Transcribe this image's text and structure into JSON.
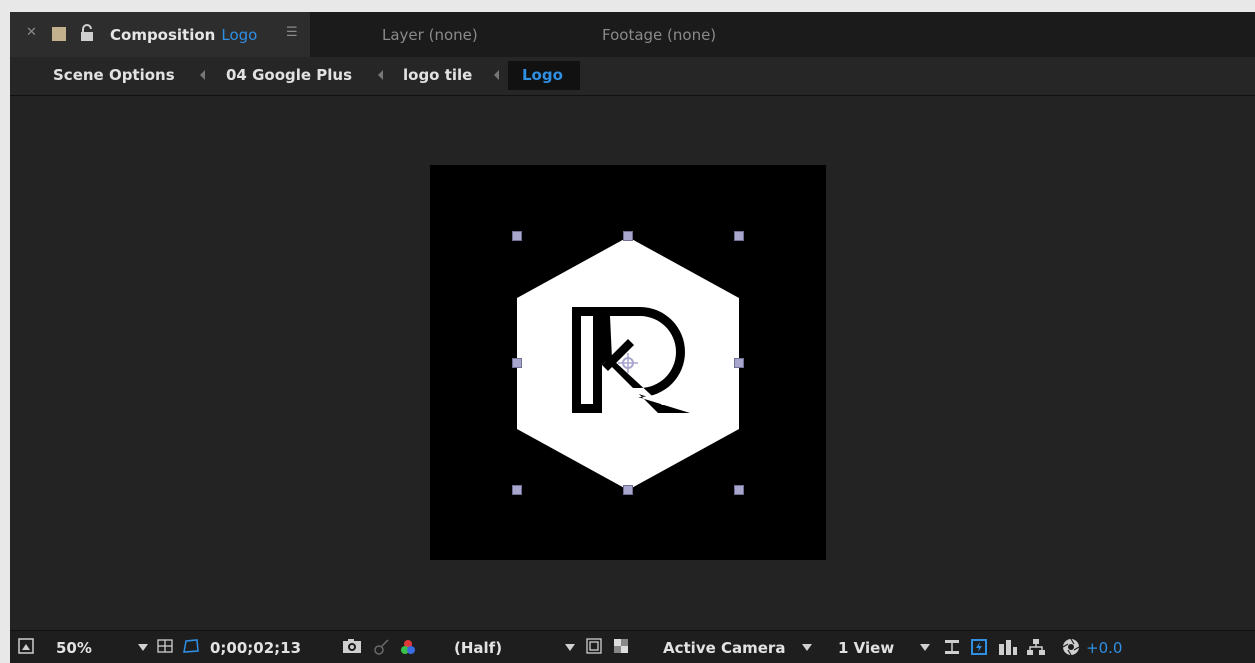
{
  "tabs": {
    "composition": {
      "label": "Composition",
      "name": "Logo"
    },
    "layer": {
      "label": "Layer (none)"
    },
    "footage": {
      "label": "Footage (none)"
    }
  },
  "breadcrumbs": [
    {
      "label": "Scene Options"
    },
    {
      "label": "04 Google Plus"
    },
    {
      "label": "logo tile"
    },
    {
      "label": "Logo",
      "current": true
    }
  ],
  "viewer": {
    "logo_letters": "KR",
    "composition_bg": "#000000",
    "logo_fill": "#ffffff"
  },
  "status_bar": {
    "zoom": "50%",
    "timecode": "0;00;02;13",
    "resolution": "(Half)",
    "camera": "Active Camera",
    "views": "1 View",
    "exposure": "+0.0"
  },
  "colors": {
    "accent": "#2f8fe3",
    "handle": "#a8a6cc",
    "label_color": "#c3b08c"
  },
  "icons": [
    "close-icon",
    "lock-icon",
    "panel-menu-icon",
    "magnifier-icon",
    "grid-icon",
    "mask-icon",
    "camera-icon",
    "show-snapshot-icon",
    "rgb-channels-icon",
    "region-of-interest-icon",
    "transparency-grid-icon",
    "fast-preview-icon",
    "timeline-icon",
    "flowchart-icon",
    "exposure-icon"
  ]
}
